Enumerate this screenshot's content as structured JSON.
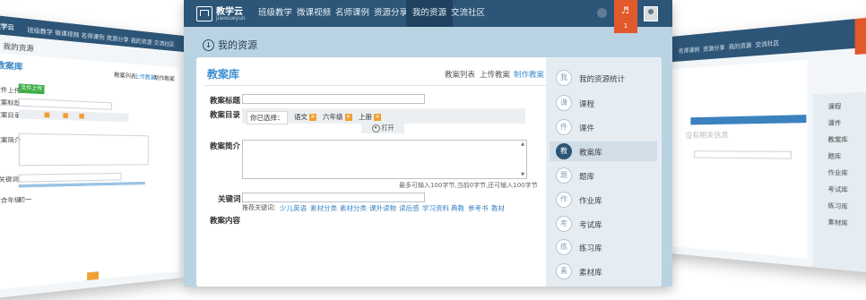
{
  "app": {
    "logo_title": "教学云",
    "logo_subtitle": "jiaoxueyun"
  },
  "nav": [
    {
      "label": "班级教学"
    },
    {
      "label": "微课视频"
    },
    {
      "label": "名师课例"
    },
    {
      "label": "资源分享"
    },
    {
      "label": "我的资源"
    },
    {
      "label": "交流社区"
    }
  ],
  "nav_active": "我的资源",
  "notifications": {
    "count": "1"
  },
  "page": {
    "title": "我的资源"
  },
  "panel": {
    "title": "教案库",
    "tabs": [
      {
        "label": "教案列表"
      },
      {
        "label": "上传教案"
      },
      {
        "label": "制作教案"
      }
    ],
    "active_tab": "制作教案"
  },
  "form": {
    "title_label": "教案标题",
    "catalog_label": "教案目录",
    "selected_label": "你已选择：",
    "chips": [
      {
        "label": "语文"
      },
      {
        "label": "六年级"
      },
      {
        "label": "上册"
      }
    ],
    "open_button": "打开",
    "intro_label": "教案简介",
    "counter": "最多可输入100字节,当前0字节,还可输入100字节",
    "keyword_label": "关键词",
    "keyword_hint": "推荐关键词：",
    "keywords": [
      "少儿英语",
      "素材分类",
      "素材分类",
      "课外读物",
      "读后感",
      "学习资料",
      "典教",
      "参考书",
      "教材"
    ],
    "content_label": "教案内容"
  },
  "sidenav": [
    {
      "icon": "我",
      "label": "我的资源统计"
    },
    {
      "icon": "课",
      "label": "课程"
    },
    {
      "icon": "件",
      "label": "课件"
    },
    {
      "icon": "教",
      "label": "教案库"
    },
    {
      "icon": "题",
      "label": "题库"
    },
    {
      "icon": "作",
      "label": "作业库"
    },
    {
      "icon": "考",
      "label": "考试库"
    },
    {
      "icon": "练",
      "label": "练习库"
    },
    {
      "icon": "素",
      "label": "素材库"
    }
  ],
  "sidenav_active": "教案库",
  "left_preview": {
    "logo": "教学云",
    "nav": [
      "班级教学",
      "微课视频",
      "名师课例",
      "资源分享",
      "我的资源",
      "交流社区"
    ],
    "page_title": "我的资源",
    "panel_title": "教案库",
    "tabs": [
      "教案列表",
      "上传教案",
      "制作教案"
    ],
    "rows": [
      "文件上传",
      "教案标题",
      "教案目录",
      "教案简介",
      "关键词",
      "适合年级"
    ],
    "upload_button": "文件上传",
    "grade_value": "初一"
  },
  "right_preview": {
    "nav": [
      "名师课例",
      "资源分享",
      "我的资源",
      "交流社区"
    ],
    "empty_text": "没有相关信息",
    "side_items": [
      "课程",
      "课件",
      "教案库",
      "题库",
      "作业库",
      "考试库",
      "练习库",
      "素材库"
    ]
  },
  "colors": {
    "topbar": "#2d5577",
    "accent": "#3c8fd1",
    "chip": "#f0a033",
    "notify": "#e2592c",
    "frame": "#b9d3e3"
  }
}
